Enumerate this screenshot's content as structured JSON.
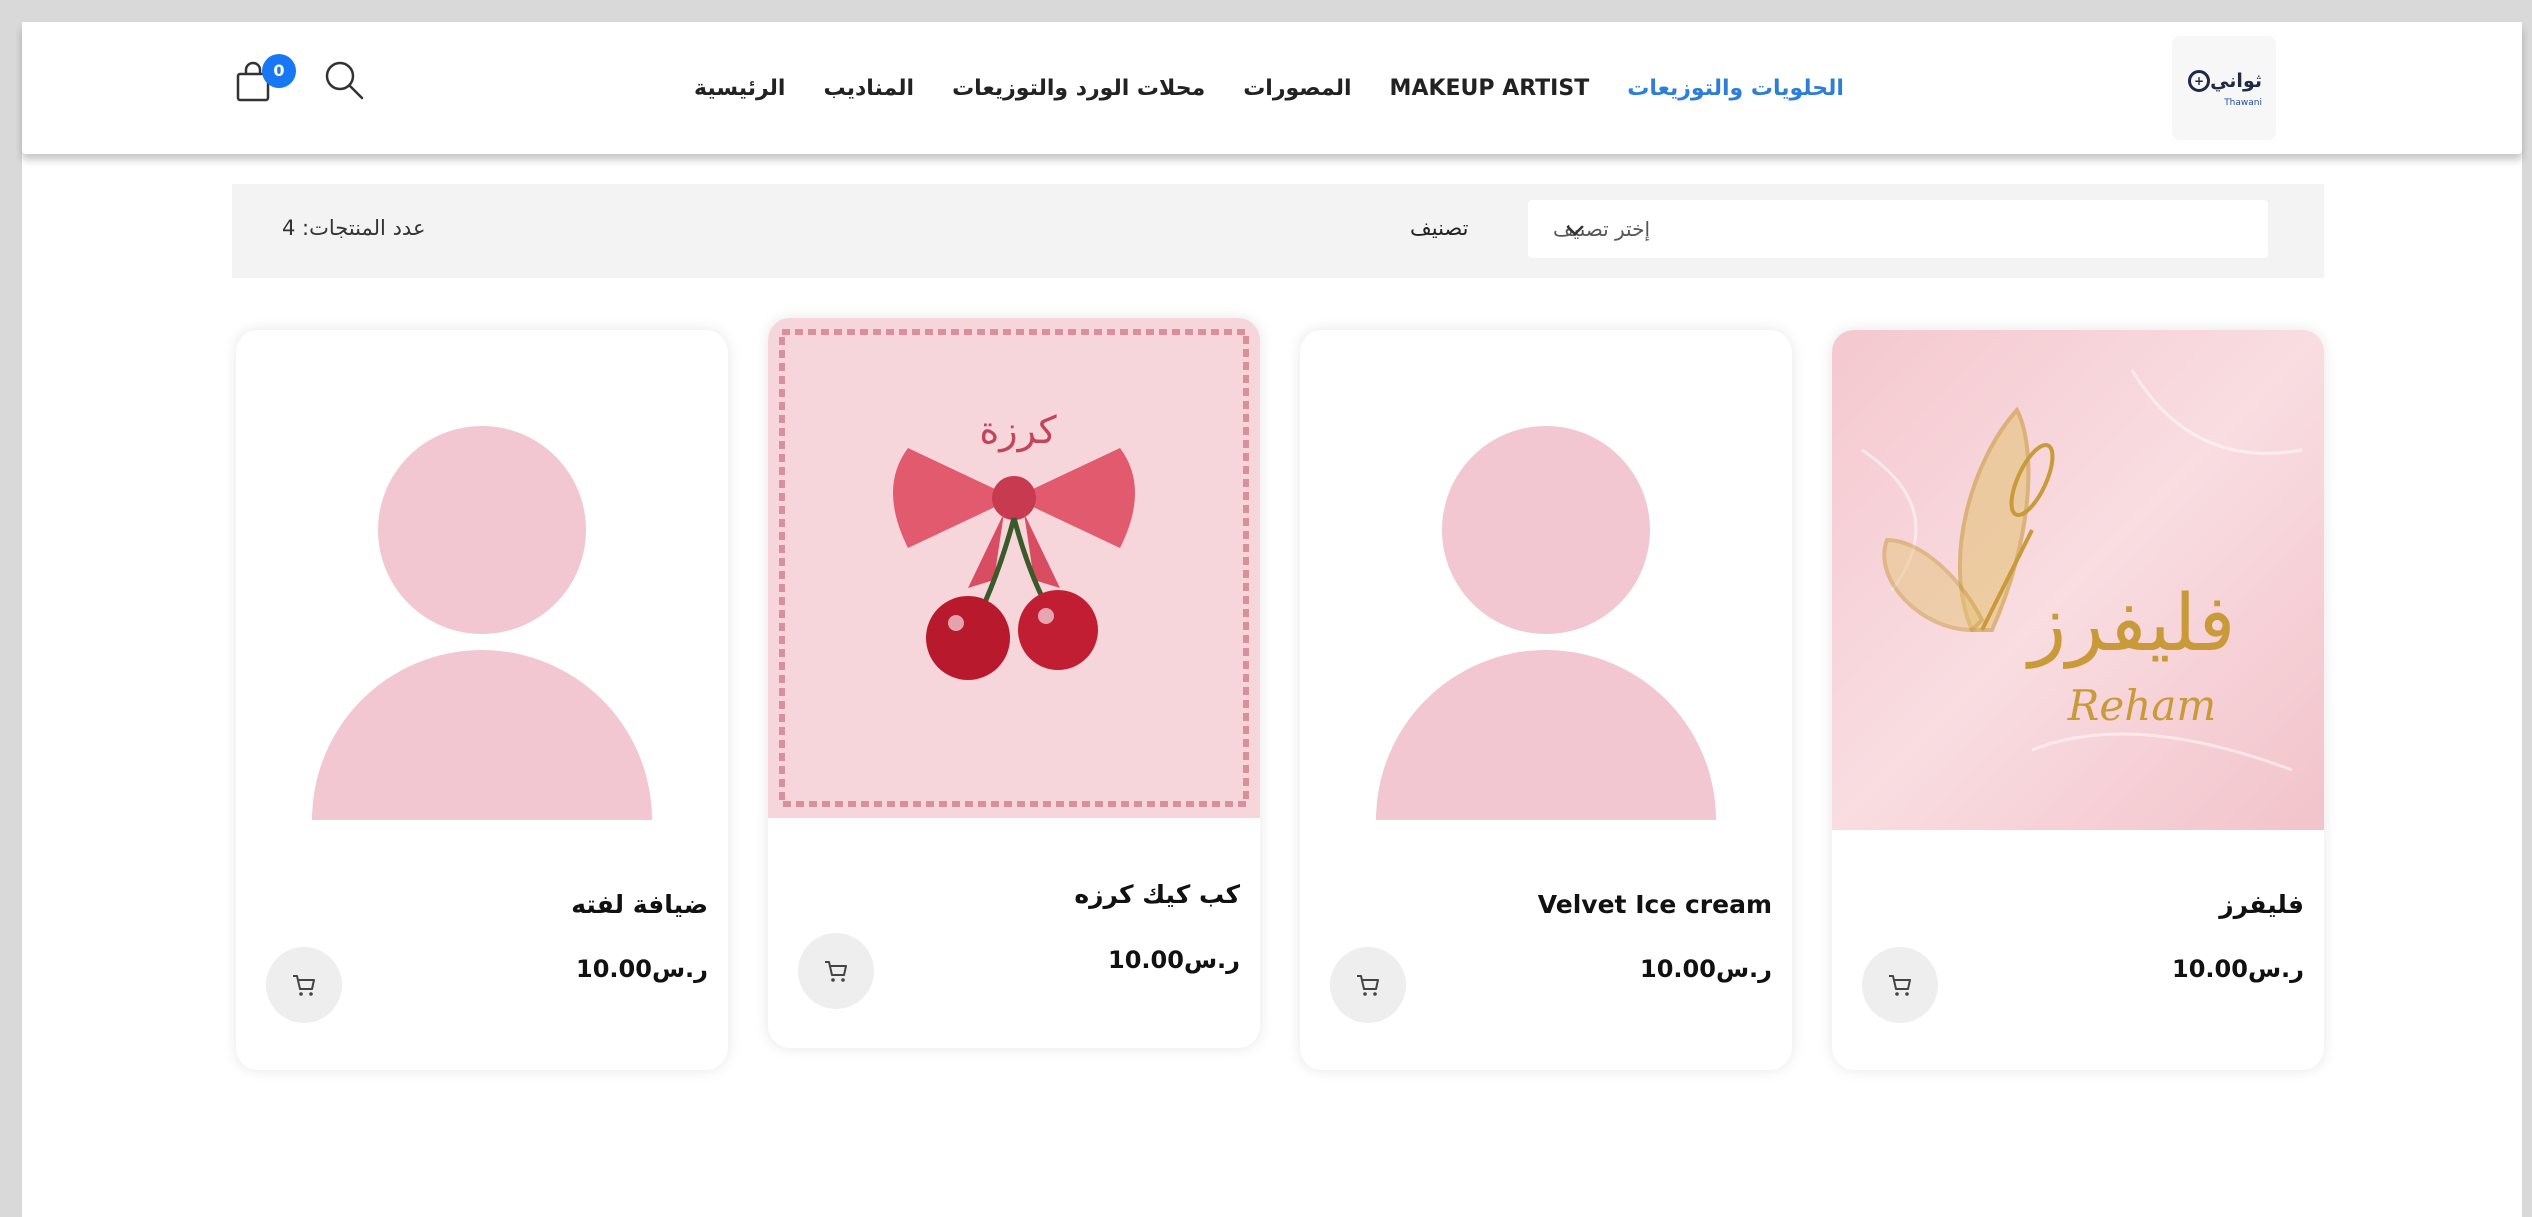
{
  "header": {
    "logo_text": "ثواني",
    "logo_sub": "Thawani",
    "nav": [
      {
        "label": "الرئيسية",
        "active": false
      },
      {
        "label": "المناديب",
        "active": false
      },
      {
        "label": "محلات الورد والتوزيعات",
        "active": false
      },
      {
        "label": "المصورات",
        "active": false
      },
      {
        "label": "MAKEUP ARTIST",
        "active": false
      },
      {
        "label": "الحلويات والتوزيعات",
        "active": true
      }
    ],
    "cart_count": "0"
  },
  "filters": {
    "product_count": "عدد المنتجات: 4",
    "category_label": "تصنيف",
    "category_placeholder": "إختر تصنيف"
  },
  "products": [
    {
      "name": "فليفرز",
      "price": "ر.س10.00",
      "image": "pink-marble-butterfly-logo",
      "logo_text": "فليفرز",
      "logo_sub": "Reham"
    },
    {
      "name": "Velvet Ice cream",
      "price": "ر.س10.00",
      "image": "placeholder-avatar"
    },
    {
      "name": "كب كيك كرزه",
      "price": "ر.س10.00",
      "image": "pink-bow-cherries-logo",
      "logo_text": "كرزة"
    },
    {
      "name": "ضيافة لفته",
      "price": "ر.س10.00",
      "image": "placeholder-avatar"
    }
  ],
  "colors": {
    "accent": "#2d7ed8",
    "badge": "#1877f2",
    "placeholder_pink": "#f2c7d1"
  }
}
